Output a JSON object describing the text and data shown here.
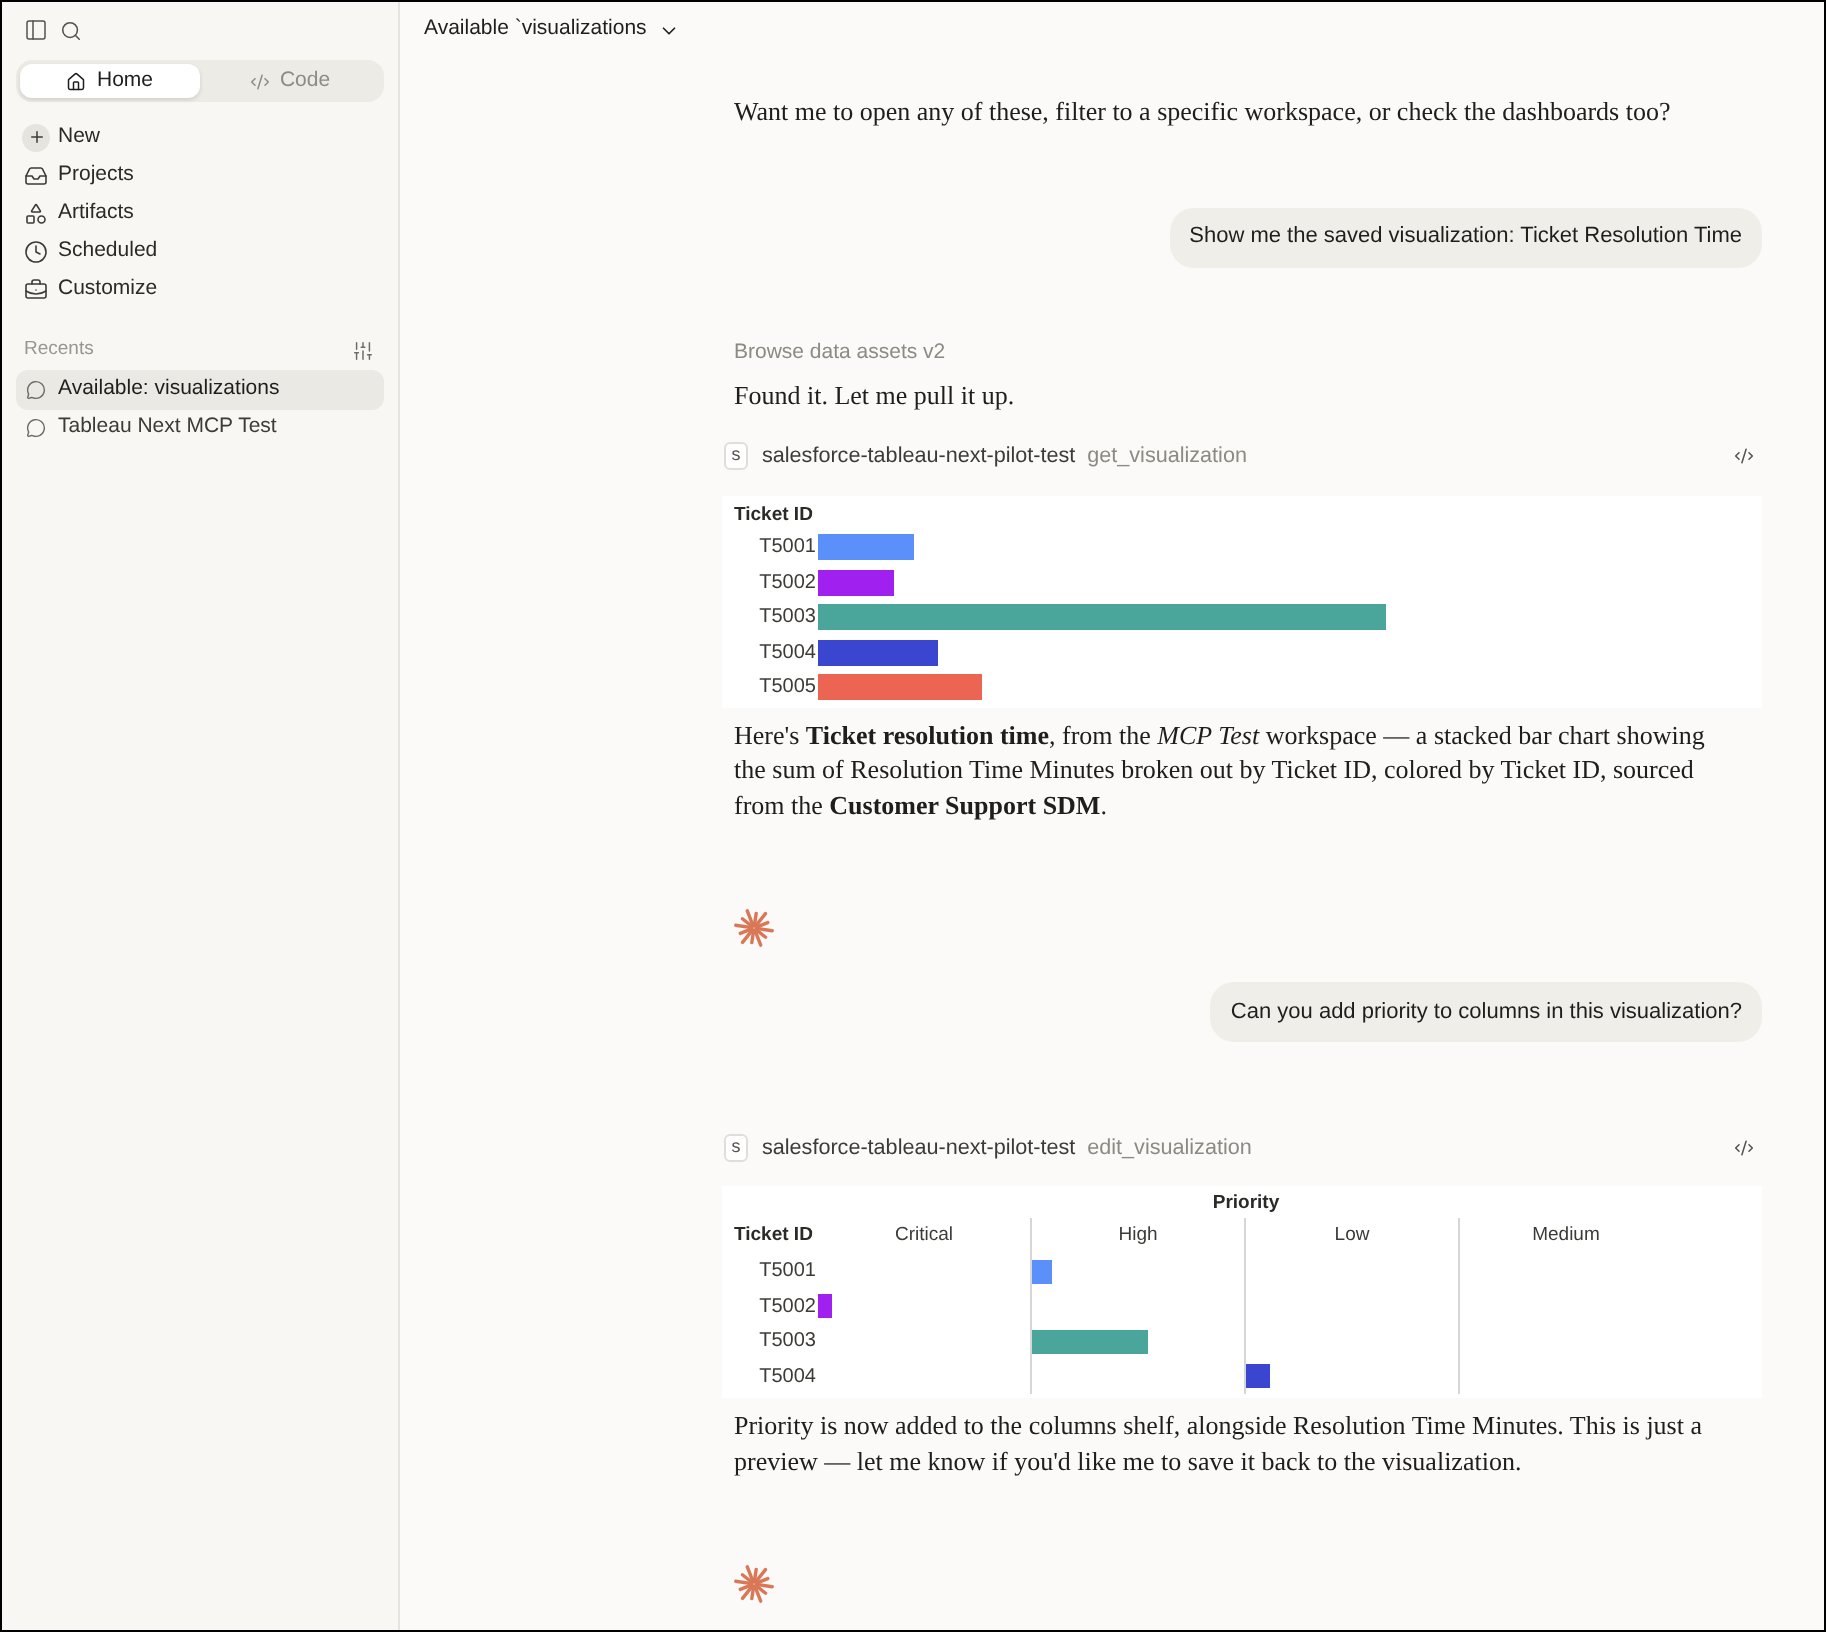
{
  "sidebar": {
    "tabs": [
      {
        "label": "Home",
        "selected": true
      },
      {
        "label": "Code",
        "selected": false
      }
    ],
    "nav": [
      {
        "label": "New"
      },
      {
        "label": "Projects"
      },
      {
        "label": "Artifacts"
      },
      {
        "label": "Scheduled"
      },
      {
        "label": "Customize"
      }
    ],
    "recents": {
      "title": "Recents",
      "items": [
        {
          "label": "Available: visualizations",
          "selected": true
        },
        {
          "label": "Tableau Next MCP Test",
          "selected": false
        }
      ]
    }
  },
  "header": {
    "title": "Available `visualizations"
  },
  "messages": [
    {
      "kind": "assistant",
      "text": "Want me to open any of these, filter to a specific workspace, or check the dashboards too?"
    },
    {
      "kind": "user",
      "text": "Show me the saved visualization: Ticket Resolution Time"
    },
    {
      "kind": "status",
      "text": "Browse data assets v2"
    },
    {
      "kind": "assistant",
      "text": "Found it. Let me pull it up."
    },
    {
      "kind": "tool",
      "badge": "s",
      "server": "salesforce-tableau-next-pilot-test",
      "tool": "get_visualization",
      "chart": {
        "kind": "bars",
        "axis_title": "Ticket ID",
        "rows": [
          {
            "label": "T5001",
            "color": "#5b8ff9"
          },
          {
            "label": "T5002",
            "color": "#a020f0"
          },
          {
            "label": "T5003",
            "color": "#4aa59a"
          },
          {
            "label": "T5004",
            "color": "#3a45d0"
          },
          {
            "label": "T5005",
            "color": "#ec6452"
          }
        ]
      }
    },
    {
      "kind": "assistant",
      "text": "Here's **Ticket resolution time**, from the *MCP Test* workspace — a stacked bar chart showing the sum of Resolution Time Minutes broken out by Ticket ID, colored by Ticket ID, sourced from the **Customer Support SDM**."
    },
    {
      "kind": "spark"
    },
    {
      "kind": "user",
      "text": "Can you add priority to columns in this visualization?"
    },
    {
      "kind": "tool",
      "badge": "s",
      "server": "salesforce-tableau-next-pilot-test",
      "tool": "edit_visualization",
      "chart": {
        "kind": "matrix",
        "title": "Priority",
        "axis_title": "Ticket ID",
        "columns": [
          "Critical",
          "High",
          "Low",
          "Medium"
        ],
        "rows": [
          {
            "label": "T5001",
            "color": "#5b8ff9"
          },
          {
            "label": "T5002",
            "color": "#a020f0"
          },
          {
            "label": "T5003",
            "color": "#4aa59a"
          },
          {
            "label": "T5004",
            "color": "#3a45d0"
          }
        ]
      }
    },
    {
      "kind": "assistant",
      "text": "Priority is now added to the columns shelf, alongside Resolution Time Minutes. This is just a preview — let me know if you'd like me to save it back to the visualization."
    },
    {
      "kind": "spark"
    }
  ]
}
